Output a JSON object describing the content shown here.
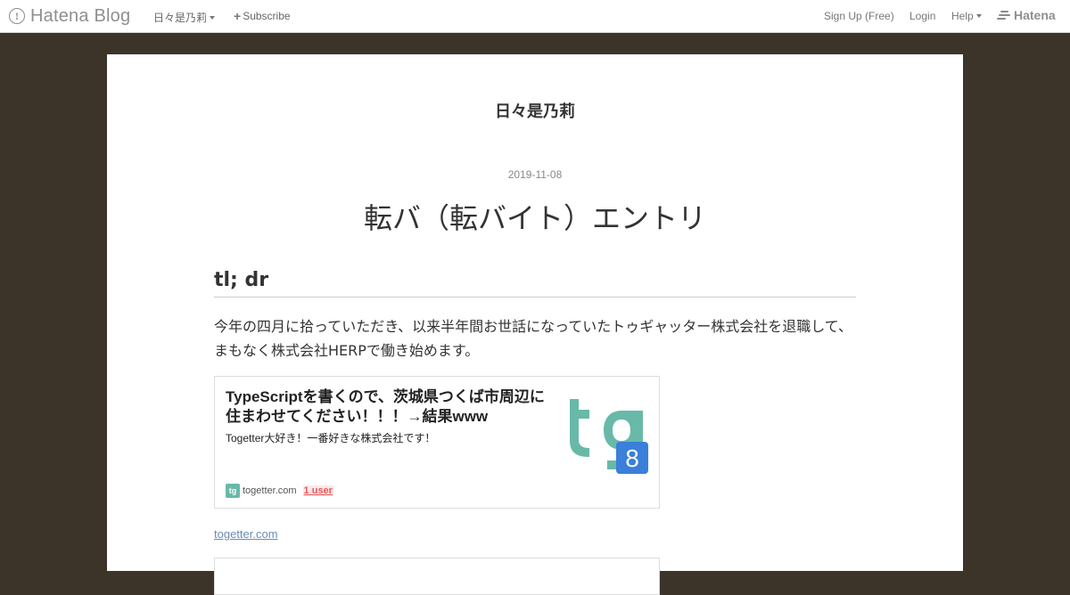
{
  "global_header": {
    "brand": "Hatena Blog",
    "blog_menu_label": "日々是乃莉",
    "subscribe_label": "Subscribe",
    "signup_label": "Sign Up (Free)",
    "login_label": "Login",
    "help_label": "Help",
    "hatena_label": "Hatena"
  },
  "blog": {
    "title": "日々是乃莉"
  },
  "entry": {
    "date": "2019-11-08",
    "title": "転バ（転バイト）エントリ",
    "section_heading": "tl; dr",
    "paragraph_lines": [
      "今年の四月に拾っていただき、以来半年間お世話になっていたトゥギャッター株式会社を退職して、",
      "まもなく株式会社HERPで働き始めます。"
    ]
  },
  "embed": {
    "title": "TypeScriptを書くので、茨城県つくば市周辺に住まわせてください！！！→結果www",
    "description": "Togetter大好き！一番好きな株式会社です！",
    "site": "togetter.com",
    "bookmark_count": "1 user",
    "link_text": "togetter.com"
  },
  "colors": {
    "page_background": "#3d3429",
    "link": "#6b8db5",
    "togetter_green": "#68b9a8",
    "togetter_blue": "#3a7fd9",
    "bookmark_red": "#e7595a"
  },
  "icons": {
    "brand_logo": "hatena-blog-logo-icon",
    "subscribe": "plus-icon",
    "hatena": "hatena-mark-icon",
    "embed_favicon": "togetter-favicon-icon",
    "embed_thumbnail": "togetter-logo-icon"
  }
}
